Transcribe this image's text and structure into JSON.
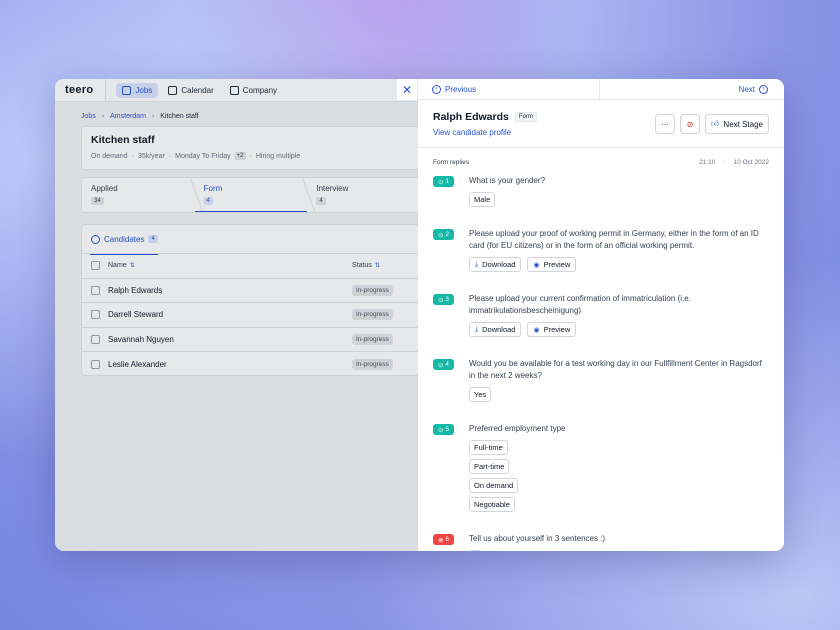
{
  "app": {
    "logo": "teero",
    "nav": [
      {
        "label": "Jobs",
        "icon": "briefcase-icon",
        "active": true
      },
      {
        "label": "Calendar",
        "icon": "calendar-icon",
        "active": false
      },
      {
        "label": "Company",
        "icon": "building-icon",
        "active": false
      }
    ],
    "breadcrumb": [
      "Jobs",
      "Amsterdam",
      "Kitchen staff"
    ],
    "job": {
      "title": "Kitchen staff",
      "meta": [
        "On demand",
        "35k/year",
        "Monday To Friday",
        "+2",
        "Hiring multiple"
      ]
    },
    "stages": [
      {
        "label": "Applied",
        "count": "34"
      },
      {
        "label": "Form",
        "count": "4"
      },
      {
        "label": "Interview",
        "count": "4"
      }
    ],
    "candidates": {
      "tab_label": "Candidates",
      "tab_count": "4",
      "columns": [
        "Name",
        "Status"
      ],
      "rows": [
        {
          "name": "Ralph Edwards",
          "status": "In-progress"
        },
        {
          "name": "Darrell Steward",
          "status": "In-progress"
        },
        {
          "name": "Savannah Nguyen",
          "status": "In-progress"
        },
        {
          "name": "Leslie Alexander",
          "status": "In-progress"
        }
      ]
    }
  },
  "panel": {
    "prev_label": "Previous",
    "next_label": "Next",
    "candidate_name": "Ralph Edwards",
    "stage_tag": "Form",
    "profile_link": "View candidate profile",
    "more_label": "···",
    "next_stage_label": "Next Stage",
    "replies_title": "Form replies",
    "reply_time": "21:10",
    "reply_date": "10 Oct 2022",
    "questions": [
      {
        "num": "1",
        "ok": true,
        "text": "What is your gender?",
        "answers": [
          "Male"
        ]
      },
      {
        "num": "2",
        "ok": true,
        "text": "Please upload your proof of working permit in Germany, either in the form of an ID card (for EU citizens) or in the form of an official working permit.",
        "files": [
          "Download",
          "Preview"
        ]
      },
      {
        "num": "3",
        "ok": true,
        "text": "Please upload your current confirmation of immatriculation (i.e. immatrikulationsbescheinigung)",
        "files": [
          "Download",
          "Preview"
        ]
      },
      {
        "num": "4",
        "ok": true,
        "text": "Would you be available for a test working day in our Fullfillment Center in Ragsdorf in the next 2 weeks?",
        "answers": [
          "Yes"
        ]
      },
      {
        "num": "5",
        "ok": true,
        "text": "Preferred employment type",
        "answers": [
          "Full-time",
          "Part-time",
          "On demand",
          "Negotiable"
        ]
      },
      {
        "num": "6",
        "ok": false,
        "text": "Tell us about yourself in 3 sentences :)",
        "answers": [
          "-"
        ]
      }
    ]
  },
  "colors": {
    "accent": "#2653d9",
    "success": "#14b8a6",
    "danger": "#ef4444"
  }
}
